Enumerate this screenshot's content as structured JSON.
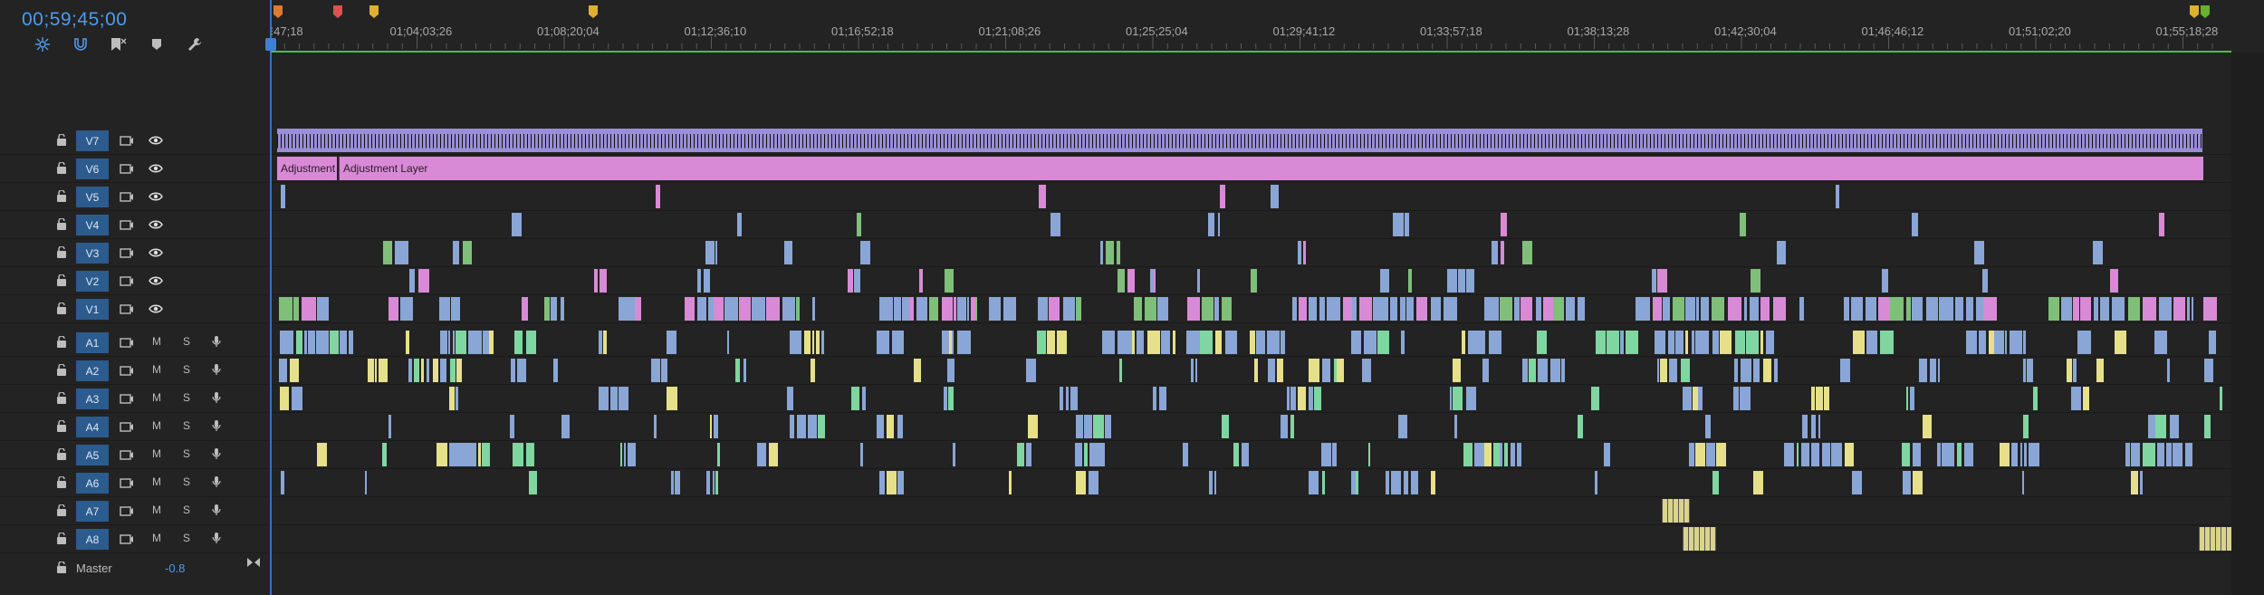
{
  "timecode": "00;59;45;00",
  "toolbar": {
    "tools": [
      {
        "name": "snap-icon",
        "label": "snap"
      },
      {
        "name": "magnet-icon",
        "label": "linked-selection"
      },
      {
        "name": "add-marker-icon",
        "label": "add-marker"
      },
      {
        "name": "marker-icon",
        "label": "marker"
      },
      {
        "name": "wrench-icon",
        "label": "settings"
      }
    ]
  },
  "ruler": {
    "ticks": [
      "47;18",
      "01;04;03;26",
      "01;08;20;04",
      "01;12;36;10",
      "01;16;52;18",
      "01;21;08;26",
      "01;25;25;04",
      "01;29;41;12",
      "01;33;57;18",
      "01;38;13;28",
      "01;42;30;04",
      "01;46;46;12",
      "01;51;02;20",
      "01;55;18;28"
    ],
    "first_prefix": "⁝"
  },
  "colors": {
    "bg": "#232323",
    "accent": "#4c9bf0",
    "track_label_bg": "#2c5b8e",
    "adjustment": "#d98ad6",
    "video_clip": "#8aa6d6",
    "audio_yellow": "#e6e08a",
    "audio_green": "#7fd6a1",
    "playhead": "#3f7fd6",
    "work_area": "#4fbf3a"
  },
  "video_tracks": [
    {
      "id": "V7",
      "label": "V7"
    },
    {
      "id": "V6",
      "label": "V6"
    },
    {
      "id": "V5",
      "label": "V5"
    },
    {
      "id": "V4",
      "label": "V4"
    },
    {
      "id": "V3",
      "label": "V3"
    },
    {
      "id": "V2",
      "label": "V2"
    },
    {
      "id": "V1",
      "label": "V1"
    }
  ],
  "audio_tracks": [
    {
      "id": "A1",
      "label": "A1"
    },
    {
      "id": "A2",
      "label": "A2"
    },
    {
      "id": "A3",
      "label": "A3"
    },
    {
      "id": "A4",
      "label": "A4"
    },
    {
      "id": "A5",
      "label": "A5"
    },
    {
      "id": "A6",
      "label": "A6"
    },
    {
      "id": "A7",
      "label": "A7"
    },
    {
      "id": "A8",
      "label": "A8"
    }
  ],
  "audio_buttons": {
    "mute": "M",
    "solo": "S"
  },
  "master": {
    "label": "Master",
    "value": "-0.8"
  },
  "clips": {
    "adjustment_short": "Adjustment",
    "adjustment_long": "Adjustment Layer"
  }
}
